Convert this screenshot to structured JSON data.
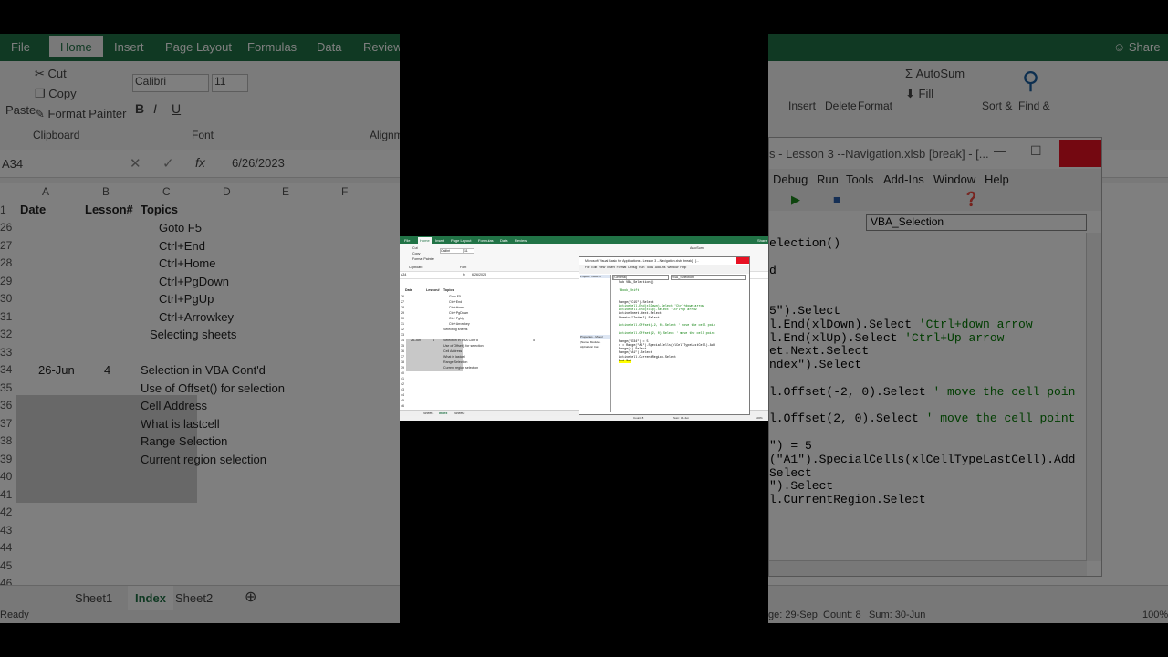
{
  "excel": {
    "tabs": [
      "File",
      "Home",
      "Insert",
      "Page Layout",
      "Formulas",
      "Data",
      "Review"
    ],
    "share_label": "Share",
    "clipboard": {
      "cut": "Cut",
      "copy": "Copy",
      "format_painter": "Format Painter",
      "paste": "Paste",
      "group": "Clipboard"
    },
    "font": {
      "name": "Calibri",
      "size": "11",
      "group": "Font",
      "align_group": "Alignm"
    },
    "editing": {
      "autosum": "AutoSum",
      "fill": "Fill",
      "insert": "Insert",
      "delete": "Delete",
      "format": "Format",
      "sort": "Sort &",
      "find": "Find &"
    },
    "name_box": "A34",
    "fx": "fx",
    "formula_value": "6/26/2023",
    "columns": [
      "A",
      "B",
      "C",
      "D",
      "E",
      "F"
    ],
    "header_row": {
      "num": "1",
      "date": "Date",
      "lesson": "Lesson#",
      "topics": "Topics"
    },
    "rows": [
      {
        "num": "26",
        "a": "",
        "b": "",
        "c": "Goto F5"
      },
      {
        "num": "27",
        "a": "",
        "b": "",
        "c": "Ctrl+End"
      },
      {
        "num": "28",
        "a": "",
        "b": "",
        "c": "Ctrl+Home"
      },
      {
        "num": "29",
        "a": "",
        "b": "",
        "c": "Ctrl+PgDown"
      },
      {
        "num": "30",
        "a": "",
        "b": "",
        "c": "Ctrl+PgUp"
      },
      {
        "num": "31",
        "a": "",
        "b": "",
        "c": "Ctrl+Arrowkey"
      },
      {
        "num": "32",
        "a": "",
        "b": "",
        "c": "Selecting sheets"
      },
      {
        "num": "33",
        "a": "",
        "b": "",
        "c": ""
      },
      {
        "num": "34",
        "a": "26-Jun",
        "b": "4",
        "c": "Selection in VBA Cont'd"
      },
      {
        "num": "35",
        "a": "",
        "b": "",
        "c": "Use of Offset() for selection"
      },
      {
        "num": "36",
        "a": "",
        "b": "",
        "c": "Cell Address"
      },
      {
        "num": "37",
        "a": "",
        "b": "",
        "c": "What is lastcell"
      },
      {
        "num": "38",
        "a": "",
        "b": "",
        "c": "Range Selection"
      },
      {
        "num": "39",
        "a": "",
        "b": "",
        "c": "Current region selection"
      },
      {
        "num": "40",
        "a": "",
        "b": "",
        "c": ""
      },
      {
        "num": "41",
        "a": "",
        "b": "",
        "c": ""
      },
      {
        "num": "42",
        "a": "",
        "b": "",
        "c": ""
      },
      {
        "num": "43",
        "a": "",
        "b": "",
        "c": ""
      },
      {
        "num": "44",
        "a": "",
        "b": "",
        "c": ""
      },
      {
        "num": "45",
        "a": "",
        "b": "",
        "c": ""
      },
      {
        "num": "46",
        "a": "",
        "b": "",
        "c": ""
      }
    ],
    "sheets": [
      "Sheet1",
      "Index",
      "Sheet2"
    ],
    "status": {
      "ready": "Ready",
      "average": "ge: 29-Sep",
      "count": "Count: 8",
      "sum": "Sum: 30-Jun",
      "zoom": "100%"
    },
    "mini_e34": "5"
  },
  "vba": {
    "title": "s - Lesson 3 --Navigation.xlsb [break] - [...",
    "menu": [
      "Debug",
      "Run",
      "Tools",
      "Add-Ins",
      "Window",
      "Help"
    ],
    "proc_combo": "VBA_Selection",
    "code_lines": [
      {
        "text": "election()",
        "comment": ""
      },
      {
        "text": "",
        "comment": ""
      },
      {
        "text": "d",
        "comment": ""
      },
      {
        "text": "",
        "comment": ""
      },
      {
        "text": "",
        "comment": ""
      },
      {
        "text": "5\").Select",
        "comment": ""
      },
      {
        "text": "l.End(xlDown).Select ",
        "comment": "'Ctrl+down arrow"
      },
      {
        "text": "l.End(xlUp).Select ",
        "comment": "'Ctrl+Up arrow"
      },
      {
        "text": "et.Next.Select",
        "comment": ""
      },
      {
        "text": "ndex\").Select",
        "comment": ""
      },
      {
        "text": "",
        "comment": ""
      },
      {
        "text": "l.Offset(-2, 0).Select ",
        "comment": "' move the cell poin"
      },
      {
        "text": "",
        "comment": ""
      },
      {
        "text": "l.Offset(2, 0).Select ",
        "comment": "' move the cell point"
      },
      {
        "text": "",
        "comment": ""
      },
      {
        "text": "\") = 5",
        "comment": ""
      },
      {
        "text": "(\"A1\").SpecialCells(xlCellTypeLastCell).Add",
        "comment": ""
      },
      {
        "text": "Select",
        "comment": ""
      },
      {
        "text": "\").Select",
        "comment": ""
      },
      {
        "text": "l.CurrentRegion.Select",
        "comment": ""
      }
    ]
  },
  "mini_vba": {
    "title": "Microsoft Visual Basic for Applications - Lesson 3 --Navigation.xlsb [break] - [...",
    "menu": "File  Edit  View  Insert  Format  Debug  Run  Tools  Add-Ins  Window  Help",
    "project_title": "Project - VBAPro",
    "properties_title": "Properties - Modul",
    "prop_name": "(Name)  Module1",
    "prop_tabs": "Alphabetic  Cat",
    "combo_left": "(General)",
    "combo_right": "VBA_Selection",
    "code": [
      "Sub VBA_Selection()",
      "",
      "'Book_Shift",
      "",
      "",
      "Range(\"C15\").Select",
      "ActiveCell.End(xlDown).Select 'Ctrl+down arrow",
      "ActiveCell.End(xlUp).Select 'Ctrl+Up arrow",
      "ActiveSheet.Next.Select",
      "Sheets(\"Index\").Select",
      "",
      "ActiveCell.Offset(-2, 0).Select ' move the cell poin",
      "",
      "ActiveCell.Offset(2, 0).Select ' move the cell point",
      "",
      "Range(\"D34\") = 5",
      "x = Range(\"A1\").SpecialCells(xlCellTypeLastCell).Add",
      "Range(x).Select",
      "Range(\"A1\").Select",
      "ActiveCell.CurrentRegion.Select",
      "End Sub"
    ]
  },
  "colors": {
    "excel_green": "#217346",
    "close_red": "#e81123",
    "comment_green": "#007a00"
  }
}
